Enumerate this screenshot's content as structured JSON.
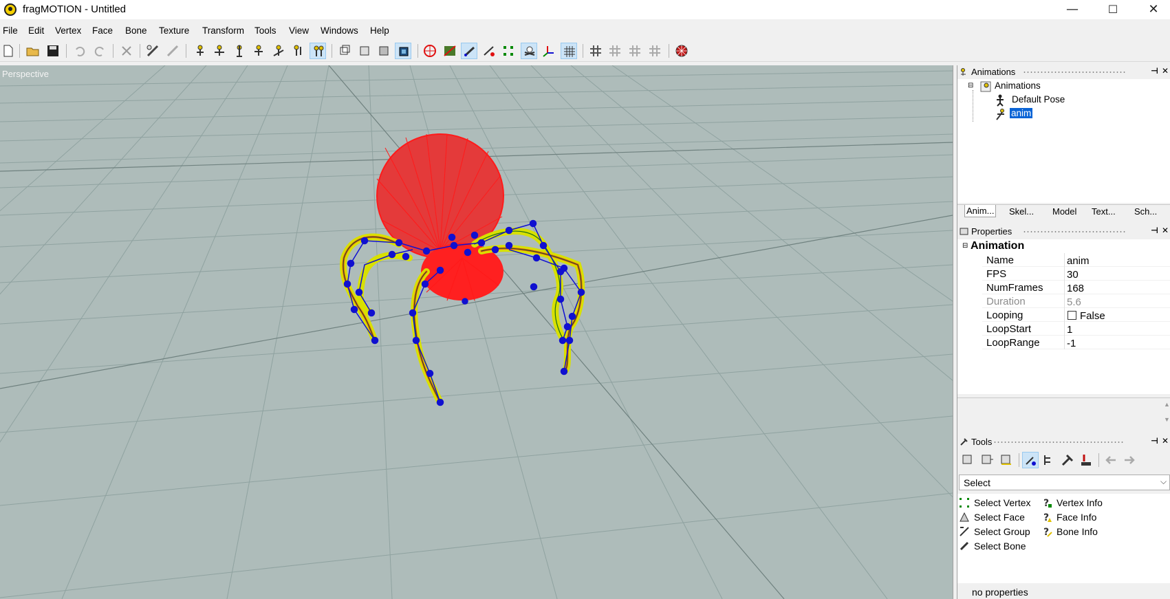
{
  "window": {
    "title": "fragMOTION - Untitled",
    "minimize_glyph": "—",
    "maximize_glyph": "☐",
    "close_glyph": "✕"
  },
  "menu": [
    "File",
    "Edit",
    "Vertex",
    "Face",
    "Bone",
    "Texture",
    "Transform",
    "Tools",
    "View",
    "Windows",
    "Help"
  ],
  "viewport": {
    "label": "Perspective",
    "background": "#aebcba"
  },
  "animations_panel": {
    "title": "Animations",
    "tree": {
      "root": "Animations",
      "children": [
        "Default Pose",
        "anim"
      ],
      "selected": "anim"
    }
  },
  "dock_tabs": [
    "Anim...",
    "Skel...",
    "Model",
    "Text...",
    "Sch..."
  ],
  "properties_panel": {
    "title": "Properties",
    "category": "Animation",
    "rows": [
      {
        "name": "Name",
        "value": "anim"
      },
      {
        "name": "FPS",
        "value": "30"
      },
      {
        "name": "NumFrames",
        "value": "168"
      },
      {
        "name": "Duration",
        "value": "5.6"
      },
      {
        "name": "Looping",
        "value": "False"
      },
      {
        "name": "LoopStart",
        "value": "1"
      },
      {
        "name": "LoopRange",
        "value": "-1"
      }
    ]
  },
  "tools_panel": {
    "title": "Tools",
    "mode_select": "Select",
    "items_left": [
      "Select Vertex",
      "Select Face",
      "Select Group",
      "Select Bone"
    ],
    "items_right": [
      "Vertex Info",
      "Face Info",
      "Bone Info"
    ],
    "status": "no properties"
  },
  "colors": {
    "selection": "#0a64d6",
    "mesh_red": "#ff1a1a",
    "bone_blue": "#1010d0",
    "leg_yellow": "#e8e800"
  }
}
